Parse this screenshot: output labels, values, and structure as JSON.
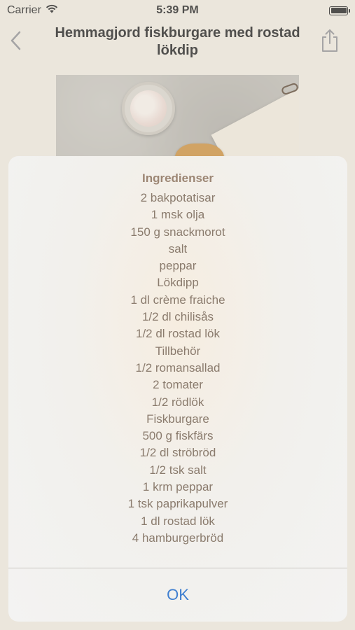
{
  "status_bar": {
    "carrier": "Carrier",
    "time": "5:39 PM"
  },
  "nav": {
    "title": "Hemmagjord fiskburgare med rostad lökdip",
    "back_icon": "chevron-left-icon",
    "share_icon": "share-icon"
  },
  "alert": {
    "title": "Ingredienser",
    "items": [
      "2 bakpotatisar",
      "1 msk olja",
      "150 g snackmorot",
      "salt",
      "peppar",
      "Lökdipp",
      "1 dl crème fraiche",
      "1/2 dl chilisås",
      "1/2 dl rostad lök",
      "Tillbehör",
      "1/2 romansallad",
      "2 tomater",
      "1/2 rödlök",
      "Fiskburgare",
      "500 g fiskfärs",
      "1/2 dl ströbröd",
      "1/2 tsk salt",
      "1 krm peppar",
      "1 tsk paprikapulver",
      "1 dl rostad lök",
      "4 hamburgerbröd"
    ],
    "ok_label": "OK"
  },
  "colors": {
    "accent": "#3f7fd0",
    "background": "#ebe6dc",
    "ingredient_text": "#8a7b6d",
    "title_text": "#9c8674"
  }
}
